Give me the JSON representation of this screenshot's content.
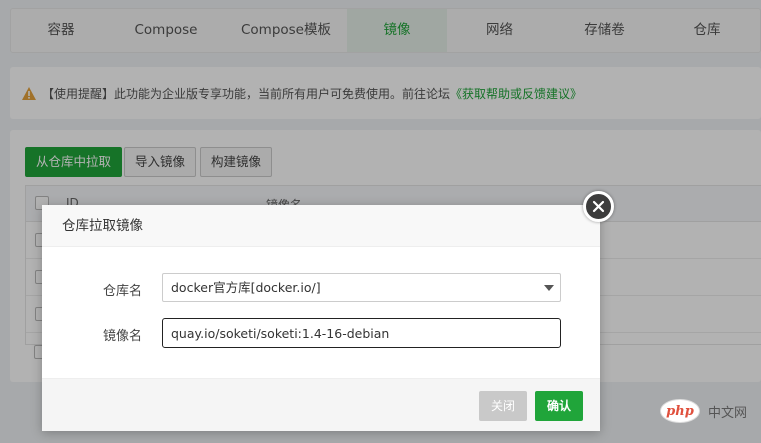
{
  "tabs": [
    {
      "label": "容器"
    },
    {
      "label": "Compose"
    },
    {
      "label": "Compose模板"
    },
    {
      "label": "镜像"
    },
    {
      "label": "网络"
    },
    {
      "label": "存储卷"
    },
    {
      "label": "仓库"
    }
  ],
  "active_tab": "镜像",
  "notice": {
    "text": "【使用提醒】此功能为企业版专享功能，当前所有用户可免费使用。前往论坛",
    "link": "《获取帮助或反馈建议》",
    "icon": "warning-icon"
  },
  "toolbar": {
    "pull_label": "从仓库中拉取",
    "import_label": "导入镜像",
    "build_label": "构建镜像"
  },
  "table": {
    "columns": [
      "ID",
      "镜像名"
    ]
  },
  "dialog": {
    "title": "仓库拉取镜像",
    "registry_label": "仓库名",
    "registry_value": "docker官方库[docker.io/]",
    "image_label": "镜像名",
    "image_value": "quay.io/soketi/soketi:1.4-16-debian",
    "close_label": "关闭",
    "confirm_label": "确认"
  },
  "watermark": {
    "logo_text": "php",
    "text": "中文网"
  },
  "colors": {
    "accent": "#20a53a",
    "warning": "#e6a23c",
    "overlay": "rgba(0,0,0,0.30)"
  }
}
